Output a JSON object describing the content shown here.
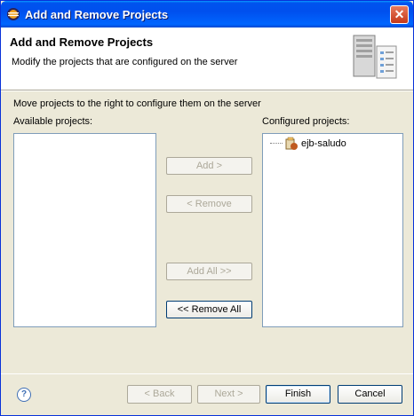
{
  "window": {
    "title": "Add and Remove Projects",
    "close_glyph": "✕"
  },
  "banner": {
    "title": "Add and Remove Projects",
    "description": "Modify the projects that are configured on the server"
  },
  "main": {
    "instruction": "Move projects to the right to configure them on the server",
    "available_label": "Available projects:",
    "configured_label": "Configured projects:",
    "available_items": [],
    "configured_items": [
      {
        "label": "ejb-saludo",
        "icon": "ejb-project-icon"
      }
    ]
  },
  "buttons": {
    "add": "Add >",
    "remove": "< Remove",
    "add_all": "Add All >>",
    "remove_all": "<< Remove All",
    "back": "< Back",
    "next": "Next >",
    "finish": "Finish",
    "cancel": "Cancel"
  },
  "help": {
    "glyph": "?"
  },
  "colors": {
    "title_bar": "#0053ee",
    "dialog_bg": "#ece9d8",
    "border": "#7f9db9"
  }
}
